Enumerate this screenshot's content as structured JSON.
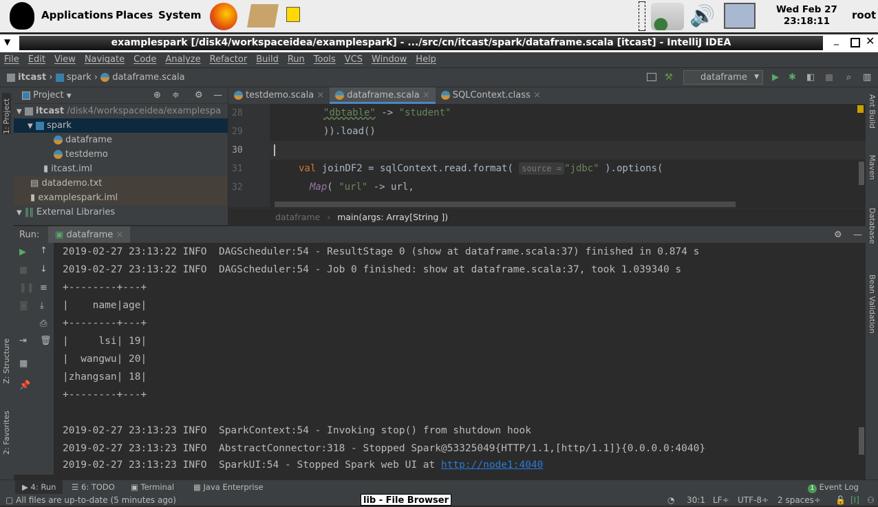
{
  "panel": {
    "applications": "Applications",
    "places": "Places",
    "system": "System",
    "date": "Wed Feb 27",
    "time": "23:18:11",
    "user": "root"
  },
  "window": {
    "title": "examplespark [/disk4/workspaceidea/examplespark] - .../src/cn/itcast/spark/dataframe.scala [itcast] - IntelliJ IDEA"
  },
  "menu": [
    "File",
    "Edit",
    "View",
    "Navigate",
    "Code",
    "Analyze",
    "Refactor",
    "Build",
    "Run",
    "Tools",
    "VCS",
    "Window",
    "Help"
  ],
  "breadcrumb": [
    "itcast",
    "spark",
    "dataframe.scala"
  ],
  "run_config": "dataframe",
  "project": {
    "title": "Project",
    "tree": [
      {
        "label": "itcast",
        "extra": "/disk4/workspaceidea/examplespa"
      },
      {
        "label": "spark"
      },
      {
        "label": "dataframe"
      },
      {
        "label": "testdemo"
      },
      {
        "label": "itcast.iml"
      },
      {
        "label": "datademo.txt"
      },
      {
        "label": "examplespark.iml"
      },
      {
        "label": "External Libraries"
      }
    ]
  },
  "left_stripe": {
    "project": "1: Project",
    "structure": "Z: Structure",
    "favorites": "2: Favorites"
  },
  "right_stripe": {
    "ant": "Ant Build",
    "maven": "Maven",
    "database": "Database",
    "bean": "Bean Validation"
  },
  "editor": {
    "tabs": [
      "testdemo.scala",
      "dataframe.scala",
      "SQLContext.class"
    ],
    "line_numbers": [
      "28",
      "29",
      "30",
      "31",
      "32"
    ],
    "code": {
      "l28a": "\"dbtable\"",
      "l28b": " -> ",
      "l28c": "\"student\"",
      "l29": ")).load()",
      "l31kw": "val ",
      "l31a": "joinDF2 = sqlContext.read.format( ",
      "l31hint": "source =",
      "l31b": "\"jdbc\"",
      "l31c": " ).options(",
      "l32a": "Map",
      "l32b": "( ",
      "l32c": "\"url\"",
      "l32d": " -> url,"
    },
    "crumb": [
      "dataframe",
      "main(args: Array[String ])"
    ]
  },
  "run": {
    "label": "Run:",
    "tab": "dataframe",
    "lines": [
      "2019-02-27 23:13:22 INFO  DAGScheduler:54 - ResultStage 0 (show at dataframe.scala:37) finished in 0.874 s",
      "2019-02-27 23:13:22 INFO  DAGScheduler:54 - Job 0 finished: show at dataframe.scala:37, took 1.039340 s",
      "+--------+---+",
      "|    name|age|",
      "+--------+---+",
      "|     lsi| 19|",
      "|  wangwu| 20|",
      "|zhangsan| 18|",
      "+--------+---+",
      "",
      "2019-02-27 23:13:23 INFO  SparkContext:54 - Invoking stop() from shutdown hook",
      "2019-02-27 23:13:23 INFO  AbstractConnector:318 - Stopped Spark@53325049{HTTP/1.1,[http/1.1]}{0.0.0.0:4040}"
    ],
    "last_line": "2019-02-27 23:13:23 INFO  SparkUI:54 - Stopped Spark web UI at ",
    "last_link": "http://node1:4040"
  },
  "tool_tabs": [
    "4: Run",
    "6: TODO",
    "Terminal",
    "Java Enterprise"
  ],
  "event_log": {
    "count": "1",
    "label": "Event Log"
  },
  "status": {
    "message": "All files are up-to-date (5 minutes ago)",
    "taskbar": "lib - File Browser",
    "position": "30:1",
    "line_sep": "LF",
    "encoding": "UTF-8",
    "indent": "2 spaces"
  }
}
